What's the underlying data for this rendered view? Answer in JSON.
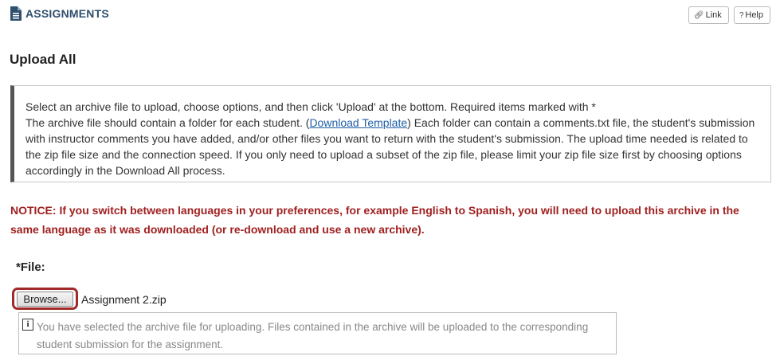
{
  "header": {
    "title": "ASSIGNMENTS",
    "icon": "document-icon",
    "link_label": "Link",
    "help_label": "Help",
    "link_icon": "link-icon",
    "help_icon": "question-icon"
  },
  "page": {
    "title": "Upload All"
  },
  "info": {
    "line1": "Select an archive file to upload, choose options, and then click 'Upload' at the bottom. Required items marked with *",
    "line2_before": "The archive file should contain a folder for each student. (",
    "download_link": "Download Template",
    "line2_after": ") Each folder can contain a comments.txt file, the student's submission with instructor comments you have added, and/or other files you want to return with the student's submission. The upload time needed is related to the zip file size and the connection speed. If you only need to upload a subset of the zip file, please limit your zip file size first by choosing options accordingly in the Download All process."
  },
  "notice": "NOTICE: If you switch between languages in your preferences, for example English to Spanish, you will need to upload this archive in the same language as it was downloaded (or re-download and use a new archive).",
  "file": {
    "label": "*File:",
    "browse_label": "Browse...",
    "selected_file": "Assignment 2.zip",
    "hint": "You have selected the archive file for uploading. Files contained in the archive will be uploaded to the corresponding student submission for the assignment.",
    "info_icon_glyph": "i"
  },
  "colors": {
    "notice": "#a02020",
    "highlight": "#a02a2a",
    "header": "#2f4f6e",
    "link": "#1e5fa8"
  }
}
